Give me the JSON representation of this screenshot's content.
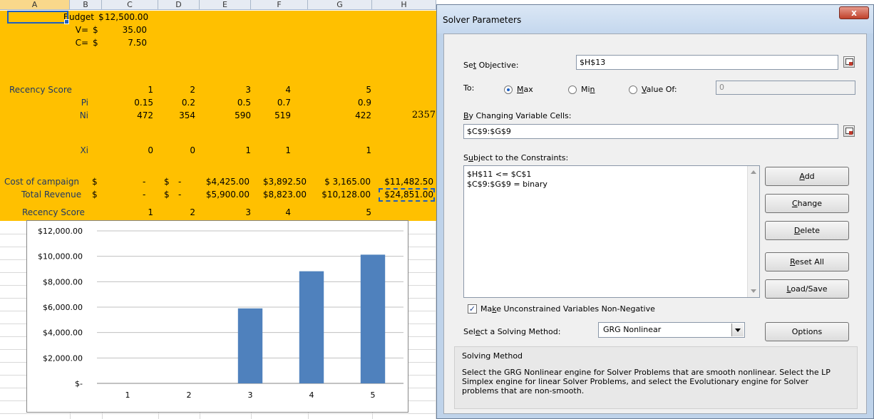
{
  "columns": [
    "A",
    "B",
    "C",
    "D",
    "E",
    "F",
    "G",
    "H"
  ],
  "spreadsheet": {
    "budget_label": "Budget",
    "budget_currency": "$",
    "budget_value": "12,500.00",
    "v_label": "V=",
    "v_currency": "$",
    "v_value": "35.00",
    "c_label": "C=",
    "c_currency": "$",
    "c_value": "7.50",
    "recency_label": "Recency Score",
    "recency_values": [
      "1",
      "2",
      "3",
      "4",
      "5"
    ],
    "pi_label": "Pi",
    "pi_values": [
      "0.15",
      "0.2",
      "0.5",
      "0.7",
      "0.9"
    ],
    "ni_label": "Ni",
    "ni_values": [
      "472",
      "354",
      "590",
      "519",
      "422"
    ],
    "ni_total": "2357",
    "xi_label": "Xi",
    "xi_values": [
      "0",
      "0",
      "1",
      "1",
      "1"
    ],
    "cost_label": "Cost of campaign",
    "cost_currency_c": "$",
    "cost_c": "-",
    "cost_currency_d": "$",
    "cost_d": "-",
    "cost_e": "$4,425.00",
    "cost_f": "$3,892.50",
    "cost_g": "$ 3,165.00",
    "cost_h": "$11,482.50",
    "revenue_label": "Total Revenue",
    "rev_currency_c": "$",
    "rev_c": "-",
    "rev_currency_d": "$",
    "rev_d": "-",
    "rev_e": "$5,900.00",
    "rev_f": "$8,823.00",
    "rev_g": "$10,128.00",
    "rev_h": "$24,851.00",
    "recency2_label": "Recency Score",
    "recency2_values": [
      "1",
      "2",
      "3",
      "4",
      "5"
    ]
  },
  "chart_data": {
    "type": "bar",
    "categories": [
      "1",
      "2",
      "3",
      "4",
      "5"
    ],
    "values": [
      0,
      0,
      5900,
      8823,
      10128
    ],
    "ylim": [
      0,
      12000
    ],
    "y_ticks": [
      "$-",
      "$2,000.00",
      "$4,000.00",
      "$6,000.00",
      "$8,000.00",
      "$10,000.00",
      "$12,000.00"
    ],
    "grid": true,
    "color": "#4f81bd",
    "title": "",
    "xlabel": "",
    "ylabel": ""
  },
  "dialog": {
    "title": "Solver Parameters",
    "close_label": "x",
    "set_objective_label": "Set Objective:",
    "set_objective_value": "$H$13",
    "to_label": "To:",
    "max_label": "Max",
    "min_label": "Min",
    "value_of_label": "Value Of:",
    "value_of_value": "0",
    "changing_cells_label": "By Changing Variable Cells:",
    "changing_cells_value": "$C$9:$G$9",
    "constraints_label": "Subject to the Constraints:",
    "constraints": [
      "$H$11 <= $C$1",
      "$C$9:$G$9 = binary"
    ],
    "buttons": {
      "add": "Add",
      "change": "Change",
      "delete": "Delete",
      "reset_all": "Reset All",
      "load_save": "Load/Save",
      "options": "Options"
    },
    "nonnegative_label": "Make Unconstrained Variables Non-Negative",
    "solving_method_label": "Select a Solving Method:",
    "solving_method_value": "GRG Nonlinear",
    "solving_method_group_title": "Solving Method",
    "solving_method_description": "Select the GRG Nonlinear engine for Solver Problems that are smooth nonlinear. Select the LP Simplex engine for linear Solver Problems, and select the Evolutionary engine for Solver problems that are non-smooth."
  },
  "colors": {
    "sheet_fill": "#ffc000",
    "label_text": "#1f3864",
    "bar": "#4f81bd",
    "dialog_frame": "#bfd3ea"
  }
}
